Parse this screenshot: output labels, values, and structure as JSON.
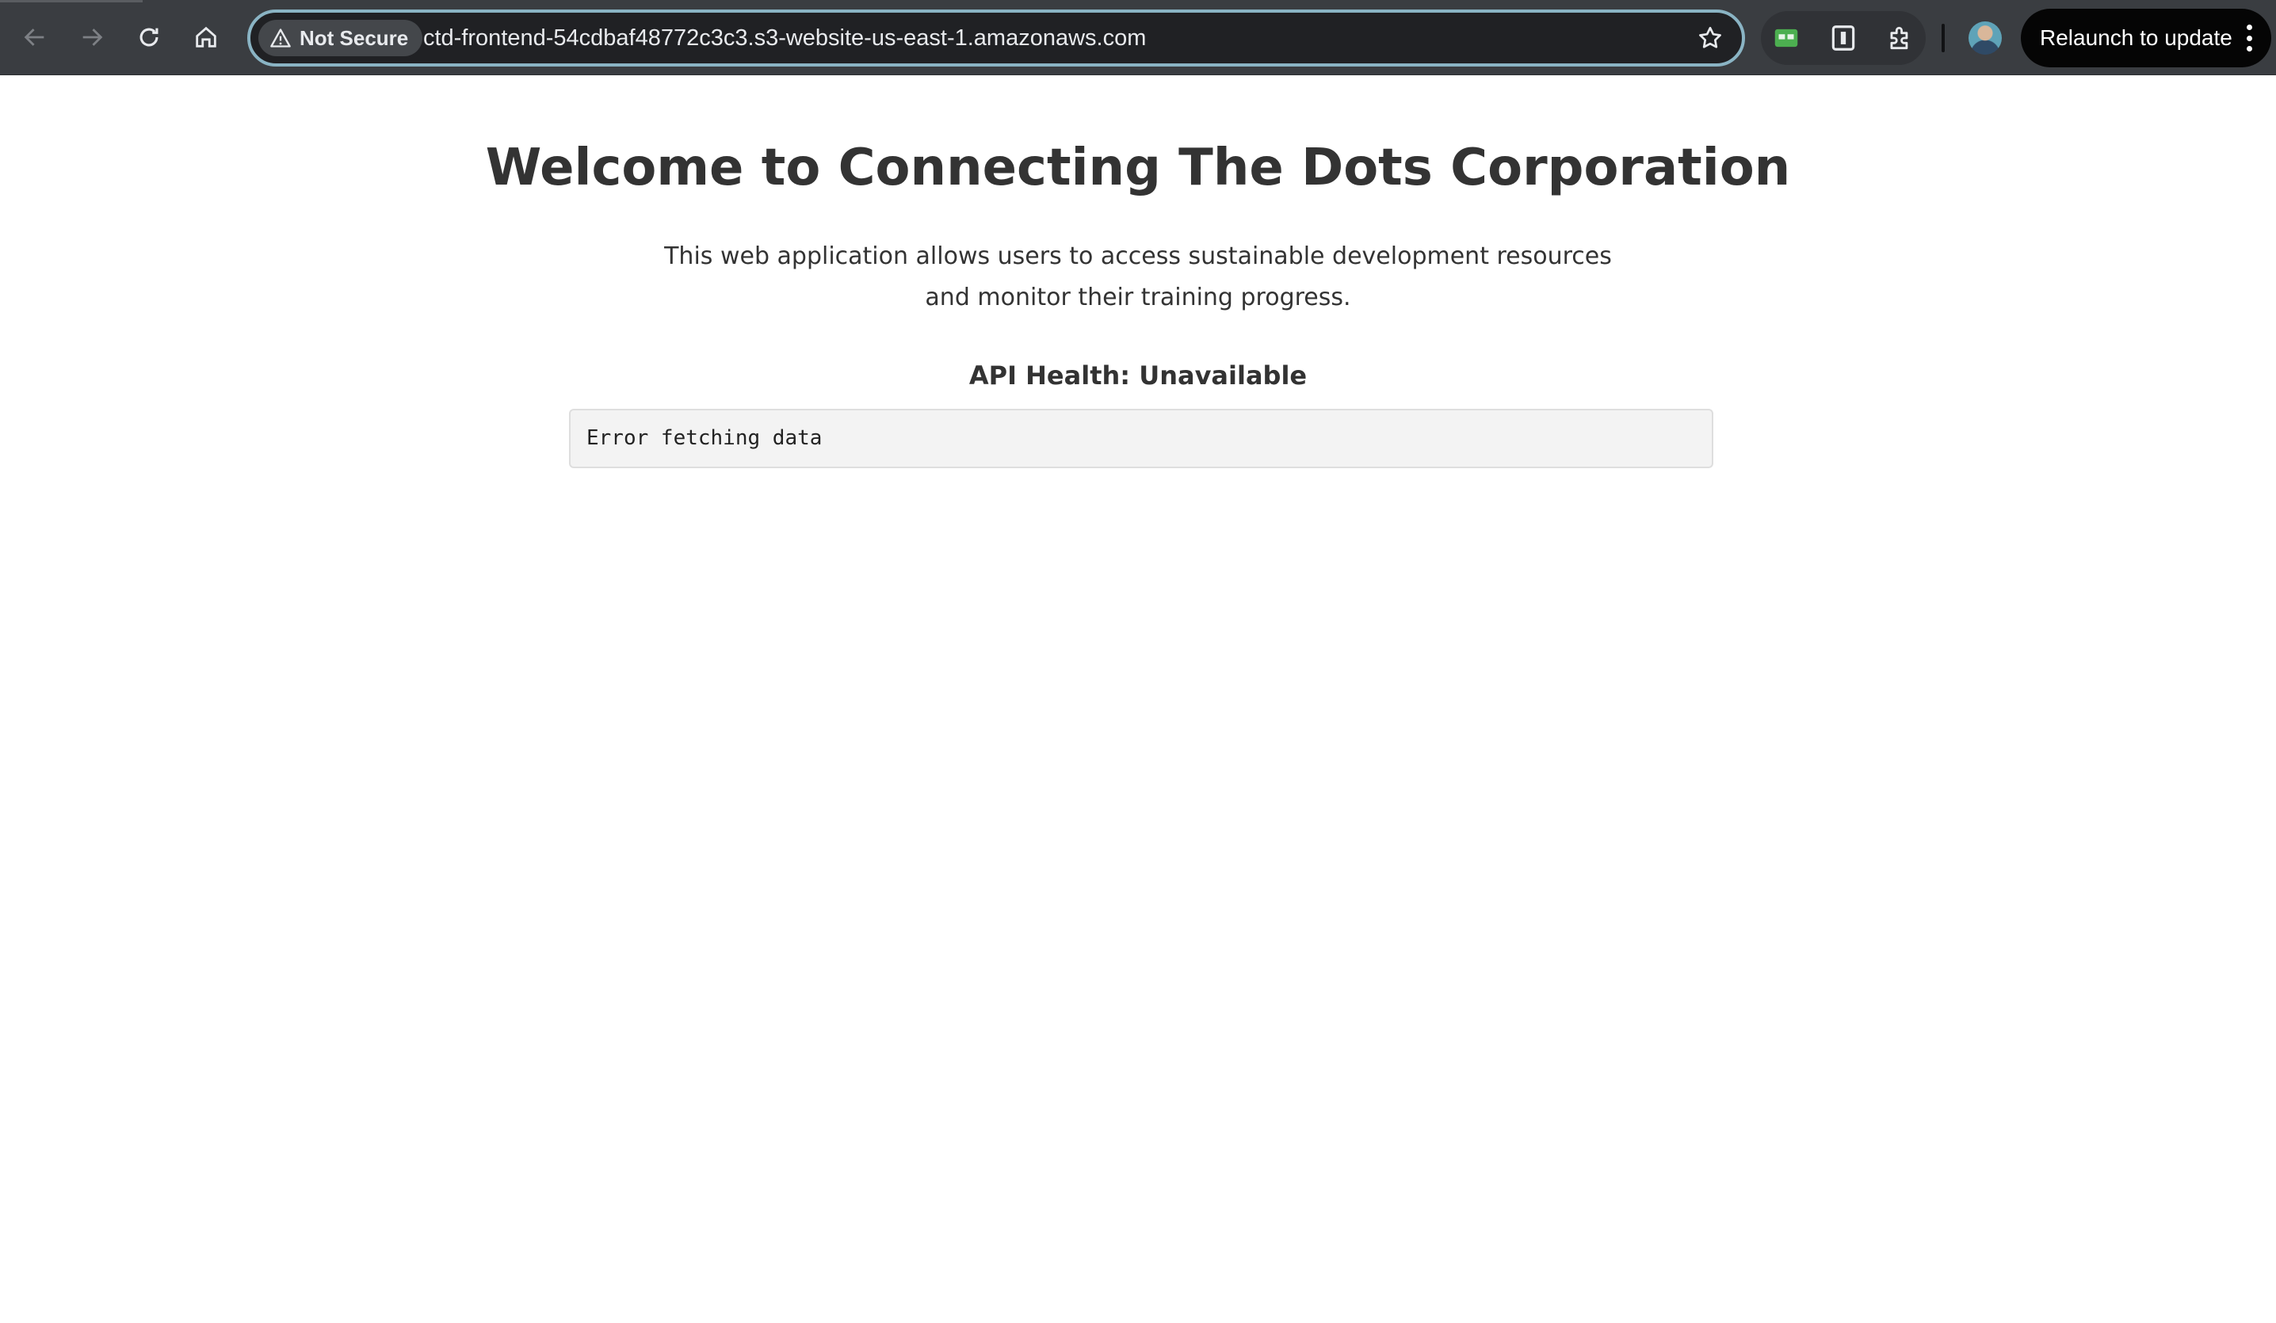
{
  "browser": {
    "security_label": "Not Secure",
    "url": "ctd-frontend-54cdbaf48772c3c3.s3-website-us-east-1.amazonaws.com",
    "relaunch_label": "Relaunch to update",
    "icons": {
      "back": "back-arrow-icon",
      "forward": "forward-arrow-icon",
      "reload": "reload-icon",
      "home": "home-icon",
      "warning": "warning-triangle-icon",
      "bookmark": "star-icon",
      "extensions": [
        "green-extension-icon",
        "info-extension-icon",
        "puzzle-icon"
      ],
      "menu": "kebab-menu-icon"
    },
    "colors": {
      "toolbar": "#3a3d41",
      "omnibox": "#202124",
      "omnibox_focus_ring": "#8ab4c4",
      "relaunch_button": "#050505"
    }
  },
  "page": {
    "title": "Welcome to Connecting The Dots Corporation",
    "intro": "This web application allows users to access sustainable development resources and monitor their training progress.",
    "health_status": "API Health: Unavailable",
    "data_output": "Error fetching data",
    "colors": {
      "text": "#333333",
      "box_background": "#f3f3f3",
      "box_border": "#dedede"
    }
  }
}
